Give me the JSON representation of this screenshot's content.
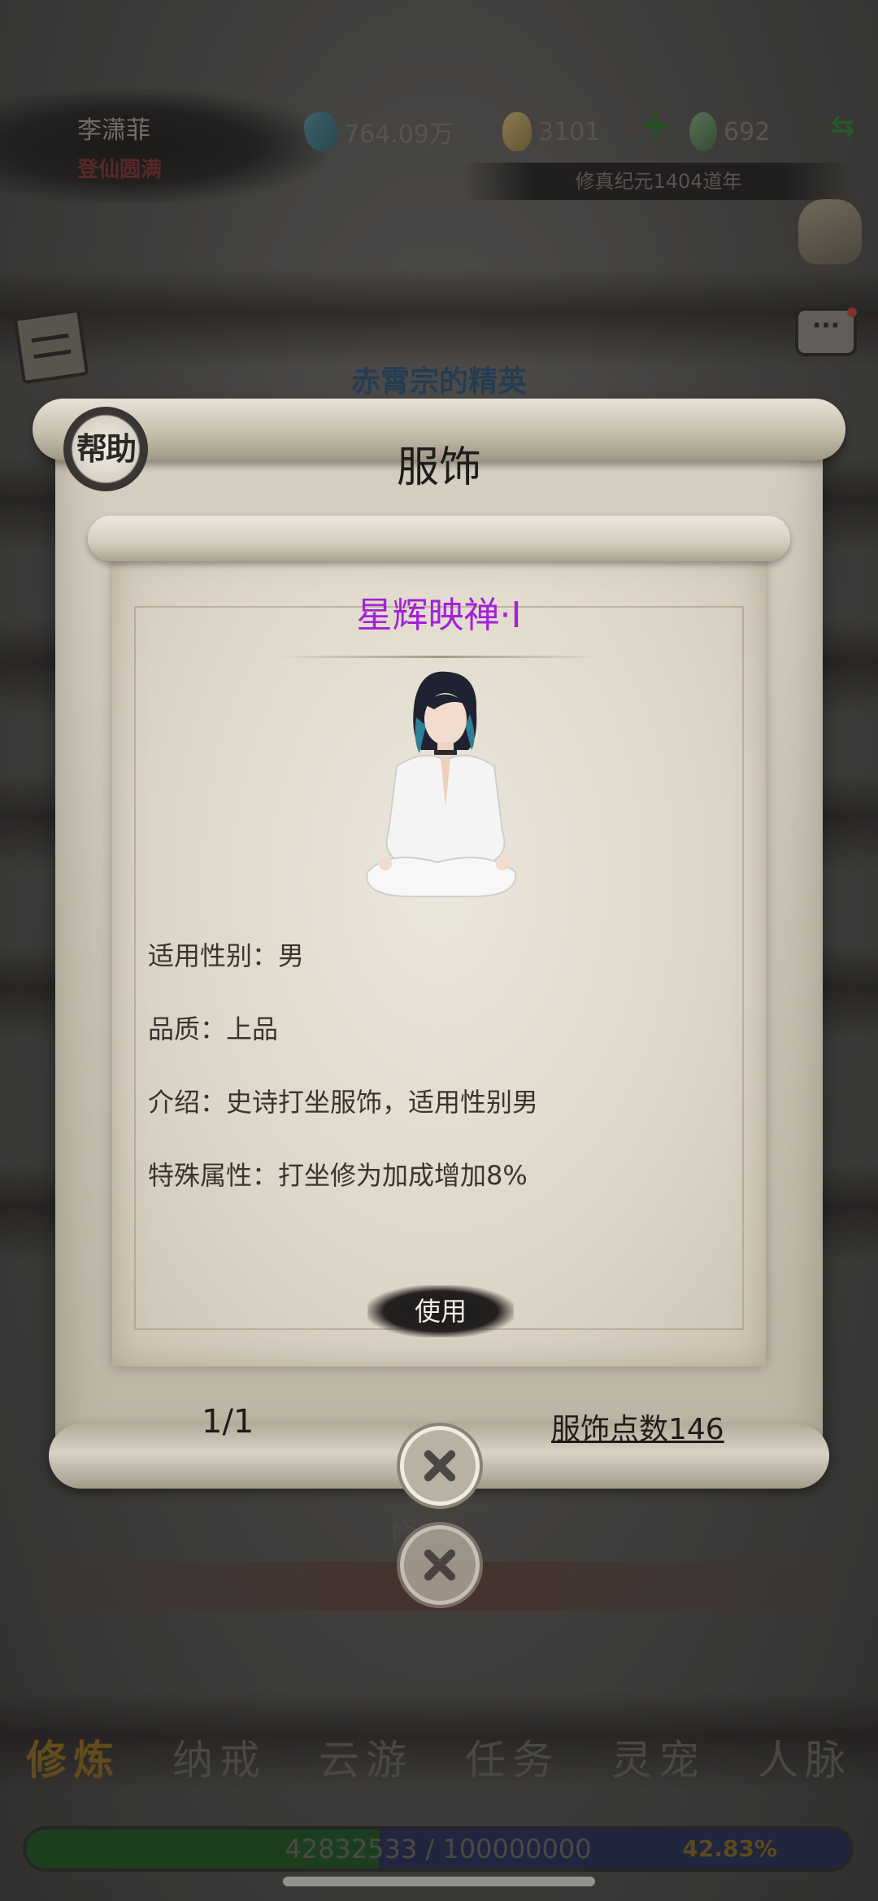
{
  "player": {
    "name": "李潇菲",
    "realm": "登仙圆满"
  },
  "resources": {
    "spirit_stones": "764.09万",
    "gold": "3101",
    "jade": "692"
  },
  "era": "修真纪元1404道年",
  "sect_title": "赤霄宗的精英",
  "background_hint": "修为",
  "modal": {
    "help_label": "帮助",
    "title": "服饰",
    "item": {
      "name": "星辉映禅·I",
      "name_color": "#a321d8",
      "gender": "适用性别：男",
      "quality": "品质：上品",
      "description": "介绍：史诗打坐服饰，适用性别男",
      "special": "特殊属性：打坐修为加成增加8%"
    },
    "use_label": "使用",
    "page": "1/1",
    "points": "服饰点数146"
  },
  "nav": [
    {
      "label": "修炼",
      "active": true
    },
    {
      "label": "纳戒"
    },
    {
      "label": "云游"
    },
    {
      "label": "任务"
    },
    {
      "label": "灵宠"
    },
    {
      "label": "人脉"
    }
  ],
  "experience": {
    "text": "42832533 / 100000000",
    "percent": "42.83%",
    "fraction": 0.4283
  },
  "icons": [
    "gem-icon",
    "coin-icon",
    "plus-icon",
    "jade-icon",
    "swap-icon",
    "bag-icon",
    "scroll-icon",
    "chat-icon",
    "close-icon"
  ]
}
